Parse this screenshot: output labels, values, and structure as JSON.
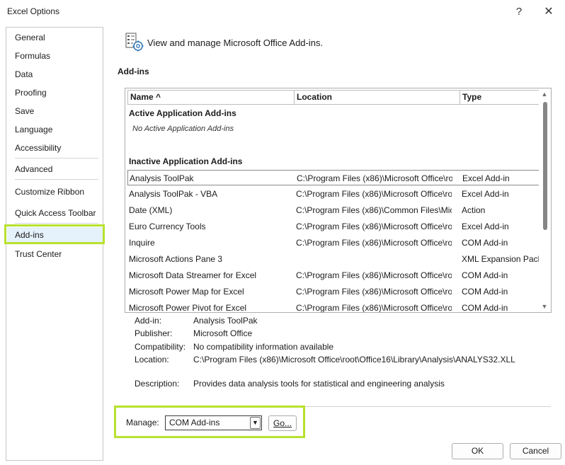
{
  "window": {
    "title": "Excel Options",
    "help_label": "?",
    "close_label": "✕"
  },
  "nav": {
    "items": [
      {
        "label": "General"
      },
      {
        "label": "Formulas"
      },
      {
        "label": "Data"
      },
      {
        "label": "Proofing"
      },
      {
        "label": "Save"
      },
      {
        "label": "Language"
      },
      {
        "label": "Accessibility"
      },
      {
        "label": "Advanced"
      },
      {
        "label": "Customize Ribbon"
      },
      {
        "label": "Quick Access Toolbar"
      },
      {
        "label": "Add-ins"
      },
      {
        "label": "Trust Center"
      }
    ],
    "selected": "Add-ins"
  },
  "header": {
    "text": "View and manage Microsoft Office Add-ins.",
    "icon": "addins-gear-icon"
  },
  "section_title": "Add-ins",
  "list": {
    "columns": [
      "Name ^",
      "Location",
      "Type"
    ],
    "active_group": "Active Application Add-ins",
    "active_empty": "No Active Application Add-ins",
    "inactive_group": "Inactive Application Add-ins",
    "rows": [
      {
        "name": "Analysis ToolPak",
        "location": "C:\\Program Files (x86)\\Microsoft Office\\ro",
        "type": "Excel Add-in"
      },
      {
        "name": "Analysis ToolPak - VBA",
        "location": "C:\\Program Files (x86)\\Microsoft Office\\ro",
        "type": "Excel Add-in"
      },
      {
        "name": "Date (XML)",
        "location": "C:\\Program Files (x86)\\Common Files\\Mic",
        "type": "Action"
      },
      {
        "name": "Euro Currency Tools",
        "location": "C:\\Program Files (x86)\\Microsoft Office\\ro",
        "type": "Excel Add-in"
      },
      {
        "name": "Inquire",
        "location": "C:\\Program Files (x86)\\Microsoft Office\\ro",
        "type": "COM Add-in"
      },
      {
        "name": "Microsoft Actions Pane 3",
        "location": "",
        "type": "XML Expansion Pack"
      },
      {
        "name": "Microsoft Data Streamer for Excel",
        "location": "C:\\Program Files (x86)\\Microsoft Office\\ro",
        "type": "COM Add-in"
      },
      {
        "name": "Microsoft Power Map for Excel",
        "location": "C:\\Program Files (x86)\\Microsoft Office\\ro",
        "type": "COM Add-in"
      },
      {
        "name": "Microsoft Power Pivot for Excel",
        "location": "C:\\Program Files (x86)\\Microsoft Office\\ro",
        "type": "COM Add-in"
      }
    ]
  },
  "details": {
    "addin_label": "Add-in:",
    "addin_value": "Analysis ToolPak",
    "publisher_label": "Publisher:",
    "publisher_value": "Microsoft Office",
    "compat_label": "Compatibility:",
    "compat_value": "No compatibility information available",
    "location_label": "Location:",
    "location_value": "C:\\Program Files (x86)\\Microsoft Office\\root\\Office16\\Library\\Analysis\\ANALYS32.XLL",
    "description_label": "Description:",
    "description_value": "Provides data analysis tools for statistical and engineering analysis"
  },
  "manage": {
    "label": "Manage:",
    "selected": "COM Add-ins",
    "go_label": "Go..."
  },
  "buttons": {
    "ok": "OK",
    "cancel": "Cancel"
  },
  "colors": {
    "highlight": "#b8e12e",
    "selected_bg": "#e5f1fb"
  }
}
